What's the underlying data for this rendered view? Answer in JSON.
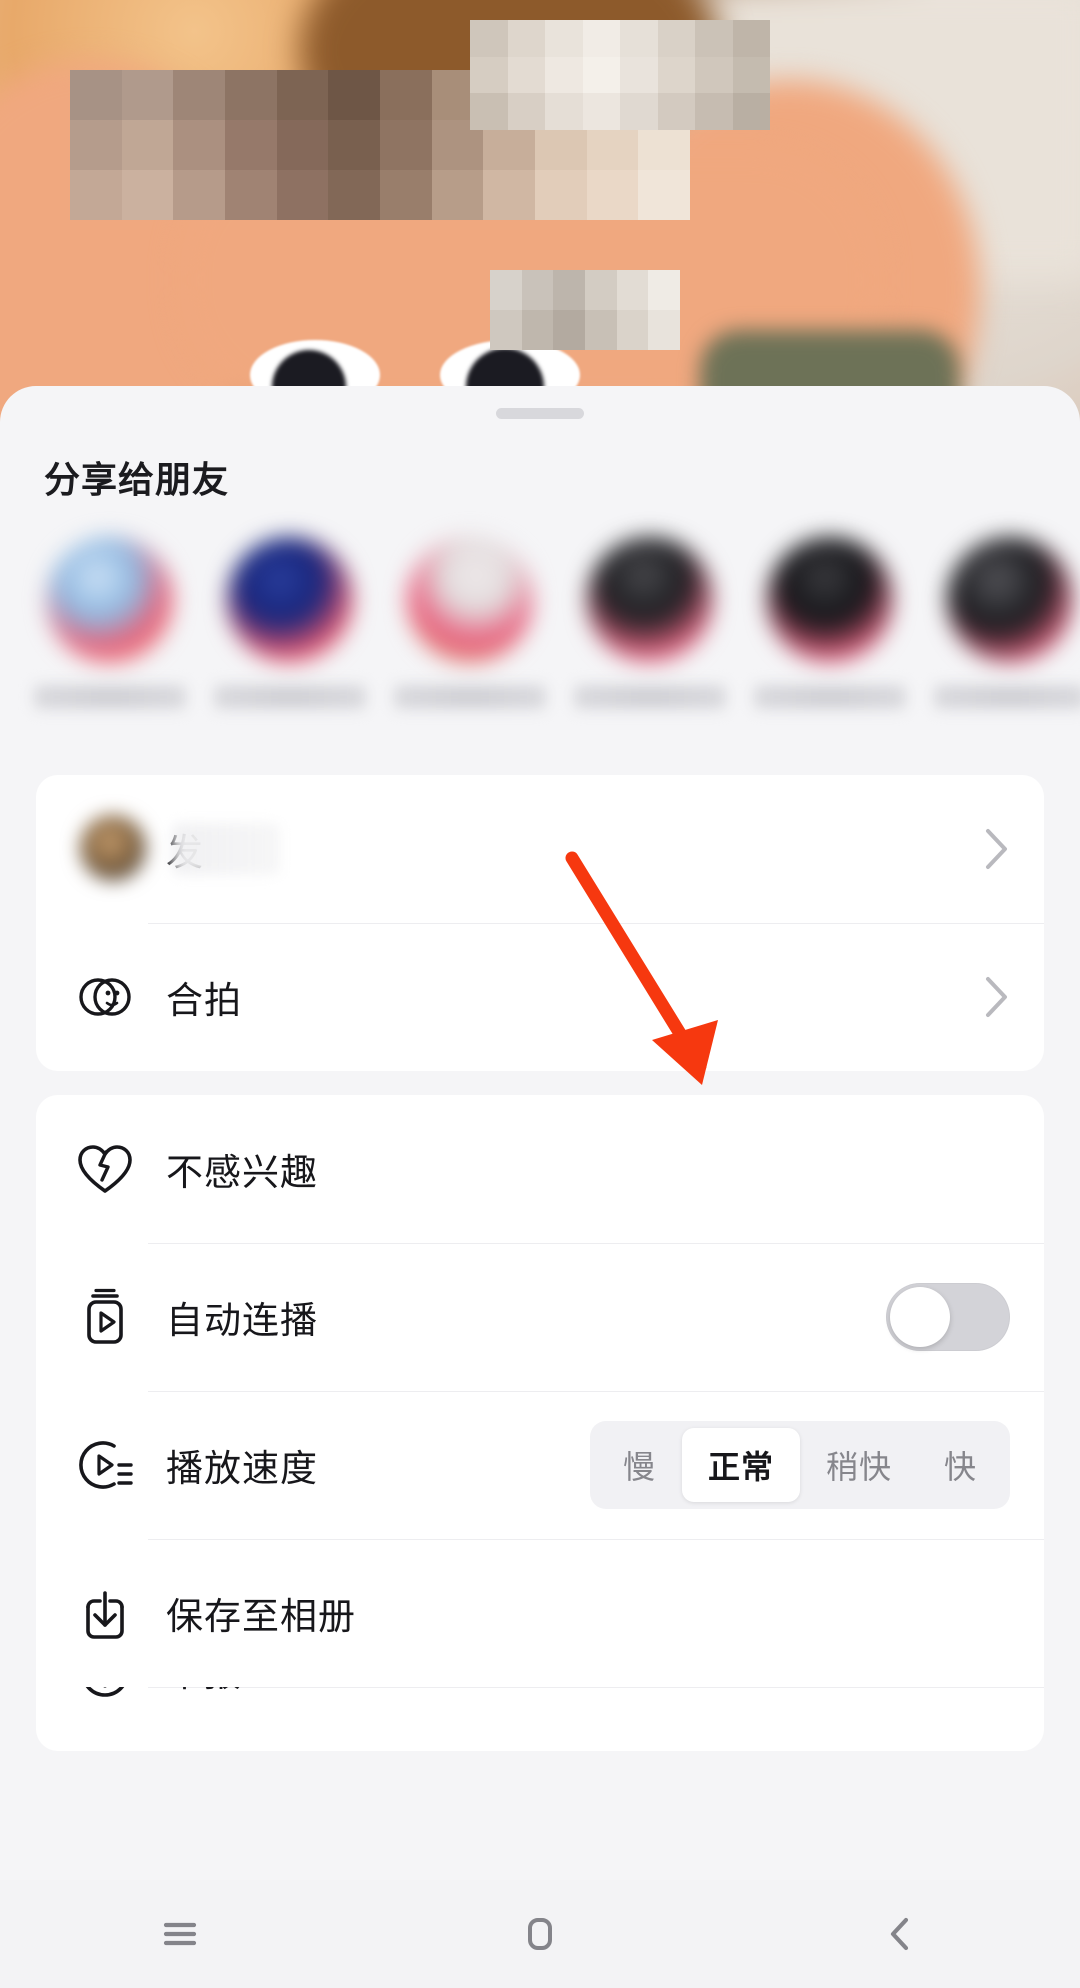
{
  "sheet": {
    "title": "分享给朋友",
    "grabber": "drag-handle"
  },
  "share_targets": [
    {
      "name": "friend-avatar-1",
      "label": ""
    },
    {
      "name": "friend-avatar-2",
      "label": ""
    },
    {
      "name": "friend-avatar-3",
      "label": ""
    },
    {
      "name": "friend-avatar-4",
      "label": ""
    },
    {
      "name": "friend-avatar-5",
      "label": ""
    },
    {
      "name": "friend-avatar-6",
      "label": ""
    }
  ],
  "card_one": {
    "rows": [
      {
        "icon": "avatar-icon",
        "label": "转发",
        "label_visible": "发",
        "accessory": "chevron-right-icon"
      },
      {
        "icon": "duet-icon",
        "label": "合拍",
        "accessory": "chevron-right-icon"
      }
    ]
  },
  "card_two": {
    "rows": [
      {
        "icon": "broken-heart-icon",
        "label": "不感兴趣",
        "accessory": "none"
      },
      {
        "icon": "autoplay-icon",
        "label": "自动连播",
        "accessory": "toggle",
        "toggle_on": false
      },
      {
        "icon": "playback-speed-icon",
        "label": "播放速度",
        "accessory": "segmented"
      },
      {
        "icon": "download-icon",
        "label": "保存至相册",
        "accessory": "none"
      },
      {
        "icon": "report-icon",
        "label": "举报",
        "accessory": "none"
      }
    ]
  },
  "speed_control": {
    "options": [
      "慢",
      "正常",
      "稍快",
      "快"
    ],
    "selected": "正常"
  },
  "navbar": {
    "items": [
      {
        "name": "recents-button",
        "glyph": "menu-icon"
      },
      {
        "name": "home-button",
        "glyph": "home-icon"
      },
      {
        "name": "back-button",
        "glyph": "back-icon"
      }
    ]
  },
  "annotation": {
    "type": "arrow",
    "color": "#F6380F",
    "points": "from (572,858) to (706,1082)",
    "target": "autoplay-toggle"
  },
  "colors": {
    "sheet_bg": "#f5f5f7",
    "card_bg": "#ffffff",
    "text_primary": "#17171b",
    "text_muted": "#86868c",
    "toggle_off": "#d3d3d8",
    "accent": "#fe2c55",
    "annotation_red": "#F6380F",
    "navbar_bg": "#f3f3f5"
  }
}
